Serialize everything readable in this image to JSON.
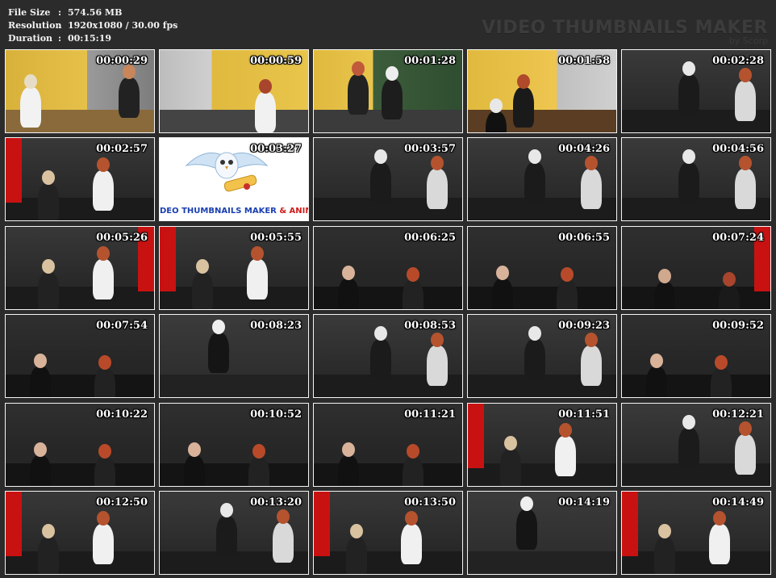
{
  "info": {
    "rows": [
      {
        "label": "File Size",
        "value": "574.56 MB"
      },
      {
        "label": "Resolution",
        "value": "1920x1080 / 30.00 fps"
      },
      {
        "label": "Duration",
        "value": "00:15:19"
      }
    ],
    "separator": ":"
  },
  "brand": {
    "title": "VIDEO THUMBNAILS MAKER",
    "subtitle": "by Scorp"
  },
  "logo_frame": {
    "text_blue": "DEO THUMBNAILS MAKER",
    "text_amp": " & ANIMAT"
  },
  "thumbnails": [
    {
      "time": "00:00:29",
      "scene": "office"
    },
    {
      "time": "00:00:59",
      "scene": "office2"
    },
    {
      "time": "00:01:28",
      "scene": "classroom"
    },
    {
      "time": "00:01:58",
      "scene": "office3"
    },
    {
      "time": "00:02:28",
      "scene": "dark"
    },
    {
      "time": "00:02:57",
      "scene": "dark-red"
    },
    {
      "time": "00:03:27",
      "scene": "logo"
    },
    {
      "time": "00:03:57",
      "scene": "dark"
    },
    {
      "time": "00:04:26",
      "scene": "dark"
    },
    {
      "time": "00:04:56",
      "scene": "dark"
    },
    {
      "time": "00:05:26",
      "scene": "dark-red"
    },
    {
      "time": "00:05:55",
      "scene": "dark-red"
    },
    {
      "time": "00:06:25",
      "scene": "floor"
    },
    {
      "time": "00:06:55",
      "scene": "floor"
    },
    {
      "time": "00:07:24",
      "scene": "floor-red"
    },
    {
      "time": "00:07:54",
      "scene": "floor"
    },
    {
      "time": "00:08:23",
      "scene": "closeup"
    },
    {
      "time": "00:08:53",
      "scene": "dark"
    },
    {
      "time": "00:09:23",
      "scene": "dark"
    },
    {
      "time": "00:09:52",
      "scene": "floor"
    },
    {
      "time": "00:10:22",
      "scene": "floor"
    },
    {
      "time": "00:10:52",
      "scene": "floor"
    },
    {
      "time": "00:11:21",
      "scene": "floor"
    },
    {
      "time": "00:11:51",
      "scene": "dark-red"
    },
    {
      "time": "00:12:21",
      "scene": "dark"
    },
    {
      "time": "00:12:50",
      "scene": "dark-red"
    },
    {
      "time": "00:13:20",
      "scene": "dark"
    },
    {
      "time": "00:13:50",
      "scene": "dark-red"
    },
    {
      "time": "00:14:19",
      "scene": "closeup"
    },
    {
      "time": "00:14:49",
      "scene": "dark-red"
    }
  ],
  "colors": {
    "background": "#2b2b2b",
    "border": "#f5f5f5",
    "timestamp": "#ffffff",
    "brand": "#3c3c3c"
  }
}
